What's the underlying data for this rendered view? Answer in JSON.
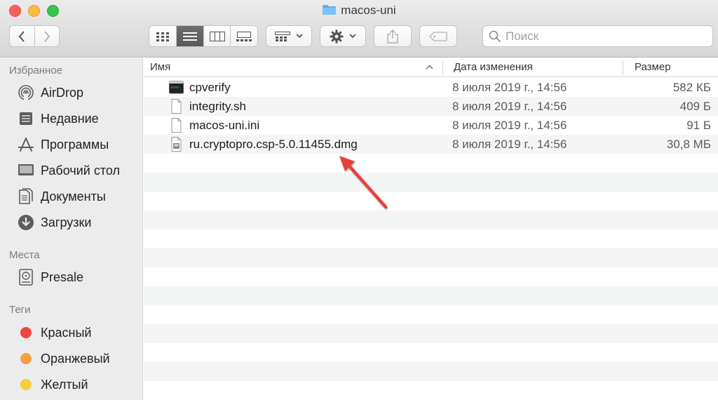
{
  "window": {
    "title": "macos-uni"
  },
  "search": {
    "placeholder": "Поиск"
  },
  "sidebar": {
    "favorites_header": "Избранное",
    "favorites": [
      {
        "label": "AirDrop",
        "icon": "airdrop-icon"
      },
      {
        "label": "Недавние",
        "icon": "recents-icon"
      },
      {
        "label": "Программы",
        "icon": "applications-icon"
      },
      {
        "label": "Рабочий стол",
        "icon": "desktop-icon"
      },
      {
        "label": "Документы",
        "icon": "documents-icon"
      },
      {
        "label": "Загрузки",
        "icon": "downloads-icon"
      }
    ],
    "places_header": "Места",
    "places": [
      {
        "label": "Presale",
        "icon": "disk-icon"
      }
    ],
    "tags_header": "Теги",
    "tags": [
      {
        "label": "Красный",
        "color": "#f1463f"
      },
      {
        "label": "Оранжевый",
        "color": "#f5a142"
      },
      {
        "label": "Желтый",
        "color": "#f7cd3d"
      }
    ]
  },
  "columns": {
    "name": "Имя",
    "date": "Дата изменения",
    "size": "Размер"
  },
  "files": [
    {
      "name": "cpverify",
      "date": "8 июля 2019 г., 14:56",
      "size": "582 КБ",
      "icon": "terminal-exec-icon"
    },
    {
      "name": "integrity.sh",
      "date": "8 июля 2019 г., 14:56",
      "size": "409 Б",
      "icon": "document-icon"
    },
    {
      "name": "macos-uni.ini",
      "date": "8 июля 2019 г., 14:56",
      "size": "91 Б",
      "icon": "document-icon"
    },
    {
      "name": "ru.cryptopro.csp-5.0.11455.dmg",
      "date": "8 июля 2019 г., 14:56",
      "size": "30,8 МБ",
      "icon": "disk-image-icon"
    }
  ],
  "annotation": {
    "color": "#e8413d"
  }
}
